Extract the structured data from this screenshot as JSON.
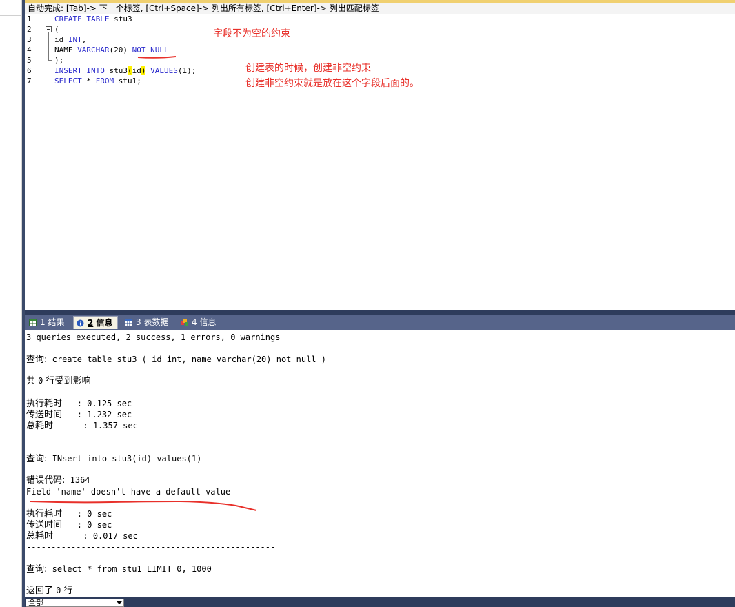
{
  "hint_bar": "自动完成: [Tab]-> 下一个标签, [Ctrl+Space]-> 列出所有标签, [Ctrl+Enter]-> 列出匹配标签",
  "editor": {
    "line_numbers": [
      "1",
      "2",
      "3",
      "4",
      "5",
      "6",
      "7"
    ],
    "lines": {
      "l1": {
        "kw": "CREATE TABLE",
        "rest": " stu3"
      },
      "l2": {
        "text": "("
      },
      "l3": {
        "a": "id ",
        "kw": "INT",
        "b": ","
      },
      "l4": {
        "a": "NAME ",
        "kw1": "VARCHAR",
        "b": "(20) ",
        "kw2": "NOT NULL"
      },
      "l5": {
        "text": ");"
      },
      "l6": {
        "kw1": "INSERT INTO",
        "a": " stu3",
        "p1": "(",
        "b": "id",
        "p2": ")",
        "c": " ",
        "kw2": "VALUES",
        "d": "(1);"
      },
      "l7": {
        "kw1": "SELECT",
        "a": " * ",
        "kw2": "FROM",
        "b": " stu1;"
      }
    }
  },
  "annotations": {
    "a1": "字段不为空的约束",
    "a2": "创建表的时候，创建非空约束",
    "a3": "创建非空约束就是放在这个字段后面的。"
  },
  "tabs": [
    {
      "num": "1",
      "label": "结果",
      "icon": "grid-results-icon"
    },
    {
      "num": "2",
      "label": "信息",
      "icon": "info-icon"
    },
    {
      "num": "3",
      "label": "表数据",
      "icon": "table-data-icon"
    },
    {
      "num": "4",
      "label": "信息",
      "icon": "info-history-icon"
    }
  ],
  "output": {
    "summary": "3 queries executed, 2 success, 1 errors, 0 warnings",
    "q1_label": "查询:",
    "q1_text": " create table stu3 ( id int, name varchar(20) not null )",
    "affected_a": "共 ",
    "affected_n": "0",
    "affected_b": " 行受到影响",
    "exec1_label": "执行耗时",
    "exec1_value": "   : 0.125 sec",
    "xfer1_label": "传送时间",
    "xfer1_value": "   : 1.232 sec",
    "total1_label": "总耗时",
    "total1_value": "      : 1.357 sec",
    "divider": "--------------------------------------------------",
    "q2_label": "查询:",
    "q2_text": " INsert into stu3(id) values(1)",
    "err_label": "错误代码:",
    "err_code": " 1364",
    "err_msg": "Field 'name' doesn't have a default value",
    "exec2_label": "执行耗时",
    "exec2_value": "   : 0 sec",
    "xfer2_label": "传送时间",
    "xfer2_value": "   : 0 sec",
    "total2_label": "总耗时",
    "total2_value": "      : 0.017 sec",
    "q3_label": "查询:",
    "q3_text": " select * from stu1 LIMIT 0, 1000",
    "ret_a": "返回了 ",
    "ret_n": "0",
    "ret_b": " 行"
  },
  "status": {
    "filter_value": "全部"
  },
  "colors": {
    "keyword": "#2a2acc",
    "annotation": "#e8302a",
    "highlight": "#fff200",
    "tabbar": "#56648a"
  }
}
